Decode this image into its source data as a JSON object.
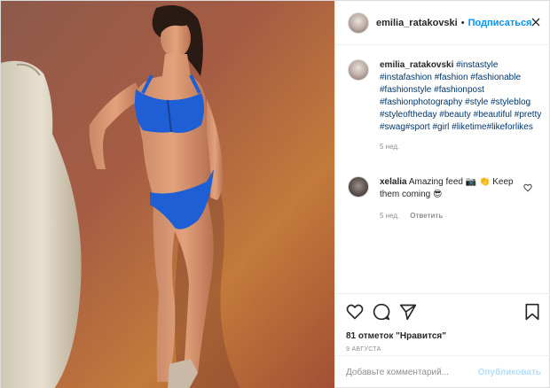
{
  "post": {
    "header": {
      "username": "emilia_ratakovski",
      "separator": "•",
      "follow_label": "Подписаться"
    },
    "caption": {
      "username": "emilia_ratakovski",
      "hashtags": "#instastyle #instafashion #fashion #fashionable #fashionstyle #fashionpost #fashionphotography #style #styleblog #styleoftheday #beauty #beautiful #pretty #swag#sport #girl #liketime#likeforlikes",
      "time": "5 нед."
    },
    "comment": {
      "username": "xelalia",
      "text": "Amazing feed 📷 👏 Keep them coming 😎",
      "time": "5 нед.",
      "reply_label": "Ответить"
    },
    "likes_text": "81 отметок \"Нравится\"",
    "date_text": "9 АВГУСТА",
    "add_comment": {
      "placeholder": "Добавьте комментарий...",
      "publish_label": "Опубликовать"
    },
    "colors": {
      "accent": "#0095f6",
      "publish_disabled": "#b2dffc",
      "swimsuit": "#1f5fd6"
    },
    "icons": [
      "more-icon",
      "heart-icon",
      "comment-icon",
      "share-icon",
      "bookmark-icon",
      "heart-small-icon"
    ]
  }
}
